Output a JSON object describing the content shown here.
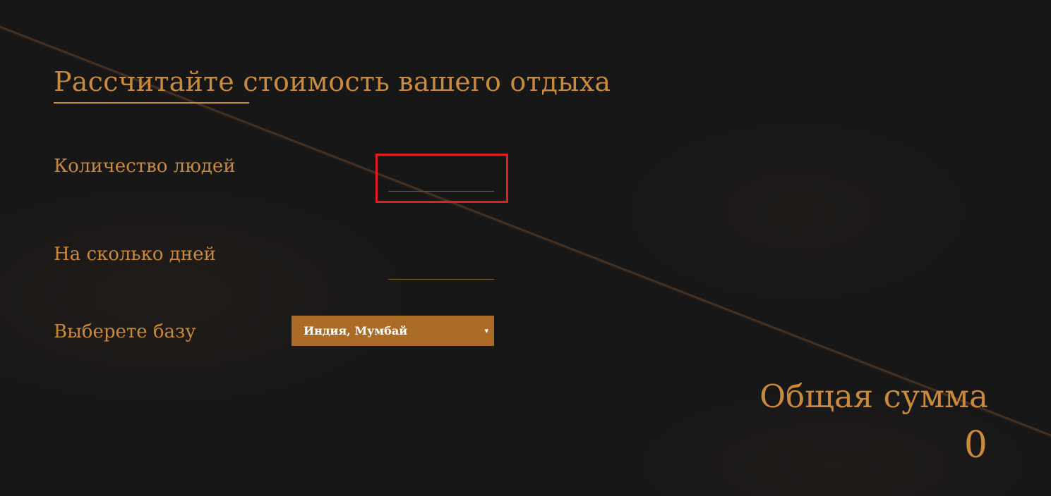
{
  "calculator": {
    "title": "Рассчитайте стоимость вашего отдыха",
    "fields": {
      "people": {
        "label": "Количество людей",
        "value": ""
      },
      "days": {
        "label": "На сколько дней",
        "value": ""
      },
      "base": {
        "label": "Выберете базу",
        "selected": "Индия, Мумбай",
        "arrow": "▾"
      }
    },
    "total": {
      "label": "Общая сумма",
      "value": "0"
    }
  },
  "colors": {
    "background": "#181718",
    "accent": "#c98a3b",
    "select_background": "#a96b26",
    "highlight": "#e31f26"
  },
  "icons": {
    "select_arrow": "chevron-down-icon"
  }
}
